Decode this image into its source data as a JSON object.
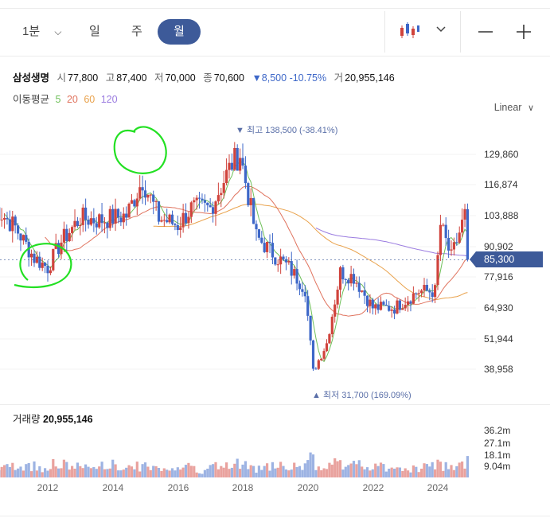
{
  "tabs": [
    {
      "label": "1분"
    },
    {
      "label": "일"
    },
    {
      "label": "주"
    },
    {
      "label": "월"
    }
  ],
  "header": {
    "name": "삼성생명",
    "open_k": "시",
    "open_v": "77,800",
    "high_k": "고",
    "high_v": "87,400",
    "low_k": "저",
    "low_v": "70,000",
    "close_k": "종",
    "close_v": "70,600",
    "change": "▼8,500 -10.75%",
    "vol_k": "거",
    "vol_v": "20,955,146"
  },
  "ma": {
    "label": "이동평균",
    "p5": "5",
    "p20": "20",
    "p60": "60",
    "p120": "120"
  },
  "scale_label": "Linear",
  "price_ticks": [
    "129,860",
    "116,874",
    "103,888",
    "90,902",
    "77,916",
    "64,930",
    "51,944",
    "38,958"
  ],
  "current_price": "85,300",
  "high_marker": "▼ 최고 138,500 (-38.41%)",
  "low_marker": "▲ 최저 31,700 (169.09%)",
  "volume": {
    "label": "거래량",
    "value": "20,955,146",
    "ticks": [
      "36.2m",
      "27.1m",
      "18.1m",
      "9.04m"
    ]
  },
  "x_ticks": [
    "2012",
    "2014",
    "2016",
    "2018",
    "2020",
    "2022",
    "2024"
  ],
  "colors": {
    "up": "#d0433c",
    "down": "#3d67c8",
    "accent": "#3d5a99",
    "ma5": "#6fc05a",
    "ma20": "#e0735e",
    "ma60": "#e9a24c",
    "ma120": "#9a7be0",
    "annotation": "#22e022"
  },
  "chart_data": {
    "type": "candlestick",
    "interval": "monthly",
    "x_range": [
      "2010-05",
      "2024-12"
    ],
    "ylim": [
      31700,
      138500
    ],
    "summary": {
      "high": 138500,
      "low": 31700,
      "last": 85300
    },
    "approx_close_path": [
      {
        "x": "2010-05",
        "y": 108000
      },
      {
        "x": "2011-01",
        "y": 99000
      },
      {
        "x": "2011-08",
        "y": 86000
      },
      {
        "x": "2012-01",
        "y": 82000
      },
      {
        "x": "2012-06",
        "y": 93000
      },
      {
        "x": "2013-01",
        "y": 103000
      },
      {
        "x": "2013-08",
        "y": 102000
      },
      {
        "x": "2014-06",
        "y": 104000
      },
      {
        "x": "2014-12",
        "y": 119000
      },
      {
        "x": "2015-06",
        "y": 103000
      },
      {
        "x": "2016-01",
        "y": 100000
      },
      {
        "x": "2016-06",
        "y": 107000
      },
      {
        "x": "2017-01",
        "y": 107000
      },
      {
        "x": "2017-09",
        "y": 126000
      },
      {
        "x": "2017-12",
        "y": 130000
      },
      {
        "x": "2018-06",
        "y": 95000
      },
      {
        "x": "2019-01",
        "y": 87000
      },
      {
        "x": "2019-06",
        "y": 82000
      },
      {
        "x": "2019-12",
        "y": 73000
      },
      {
        "x": "2020-03",
        "y": 38000
      },
      {
        "x": "2020-08",
        "y": 50000
      },
      {
        "x": "2021-01",
        "y": 80000
      },
      {
        "x": "2021-06",
        "y": 78000
      },
      {
        "x": "2022-01",
        "y": 65000
      },
      {
        "x": "2022-09",
        "y": 65000
      },
      {
        "x": "2023-06",
        "y": 72000
      },
      {
        "x": "2023-12",
        "y": 72000
      },
      {
        "x": "2024-02",
        "y": 100000
      },
      {
        "x": "2024-06",
        "y": 86000
      },
      {
        "x": "2024-11",
        "y": 104000
      },
      {
        "x": "2024-12",
        "y": 85300
      }
    ]
  }
}
